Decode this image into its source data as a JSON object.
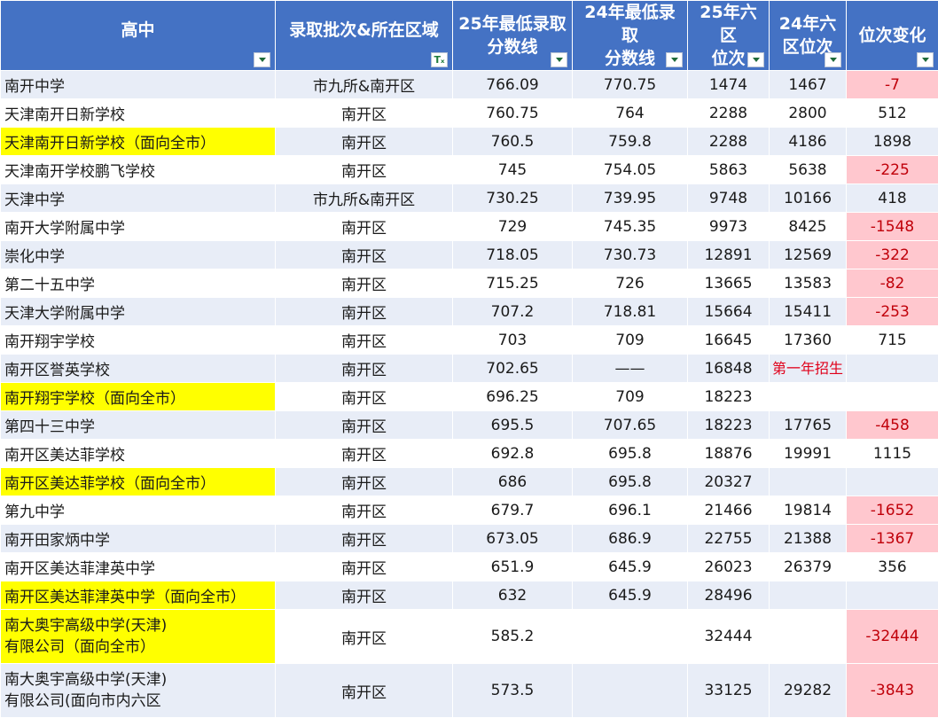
{
  "headers": [
    {
      "label": "高中"
    },
    {
      "label": "录取批次&所在区域"
    },
    {
      "label": "25年最低录取\n分数线"
    },
    {
      "label": "24年最低录取\n分数线"
    },
    {
      "label": "25年六区\n位次"
    },
    {
      "label": "24年六\n区位次"
    },
    {
      "label": "位次变化"
    }
  ],
  "rows": [
    {
      "name": "南开中学",
      "batch": "市九所&南开区",
      "s25": "766.09",
      "s24": "770.75",
      "r25": "1474",
      "r24": "1467",
      "chg": "-7"
    },
    {
      "name": "天津南开日新学校",
      "batch": "南开区",
      "s25": "760.75",
      "s24": "764",
      "r25": "2288",
      "r24": "2800",
      "chg": "512"
    },
    {
      "name": "天津南开日新学校（面向全市）",
      "batch": "南开区",
      "s25": "760.5",
      "s24": "759.8",
      "r25": "2288",
      "r24": "4186",
      "chg": "1898"
    },
    {
      "name": "天津南开学校鹏飞学校",
      "batch": "南开区",
      "s25": "745",
      "s24": "754.05",
      "r25": "5863",
      "r24": "5638",
      "chg": "-225"
    },
    {
      "name": "天津中学",
      "batch": "市九所&南开区",
      "s25": "730.25",
      "s24": "739.95",
      "r25": "9748",
      "r24": "10166",
      "chg": "418"
    },
    {
      "name": "南开大学附属中学",
      "batch": "南开区",
      "s25": "729",
      "s24": "745.35",
      "r25": "9973",
      "r24": "8425",
      "chg": "-1548"
    },
    {
      "name": "崇化中学",
      "batch": "南开区",
      "s25": "718.05",
      "s24": "730.73",
      "r25": "12891",
      "r24": "12569",
      "chg": "-322"
    },
    {
      "name": "第二十五中学",
      "batch": "南开区",
      "s25": "715.25",
      "s24": "726",
      "r25": "13665",
      "r24": "13583",
      "chg": "-82"
    },
    {
      "name": "天津大学附属中学",
      "batch": "南开区",
      "s25": "707.2",
      "s24": "718.81",
      "r25": "15664",
      "r24": "15411",
      "chg": "-253"
    },
    {
      "name": "南开翔宇学校",
      "batch": "南开区",
      "s25": "703",
      "s24": "709",
      "r25": "16645",
      "r24": "17360",
      "chg": "715"
    },
    {
      "name": "南开区誉英学校",
      "batch": "南开区",
      "s25": "702.65",
      "s24": "——",
      "r25": "16848",
      "r24": "第一年招生",
      "chg": ""
    },
    {
      "name": "南开翔宇学校（面向全市）",
      "batch": "南开区",
      "s25": "696.25",
      "s24": "709",
      "r25": "18223",
      "r24": "",
      "chg": ""
    },
    {
      "name": "第四十三中学",
      "batch": "南开区",
      "s25": "695.5",
      "s24": "707.65",
      "r25": "18223",
      "r24": "17765",
      "chg": "-458"
    },
    {
      "name": "南开区美达菲学校",
      "batch": "南开区",
      "s25": "692.8",
      "s24": "695.8",
      "r25": "18876",
      "r24": "19991",
      "chg": "1115"
    },
    {
      "name": "南开区美达菲学校（面向全市）",
      "batch": "南开区",
      "s25": "686",
      "s24": "695.8",
      "r25": "20327",
      "r24": "",
      "chg": ""
    },
    {
      "name": "第九中学",
      "batch": "南开区",
      "s25": "679.7",
      "s24": "696.1",
      "r25": "21466",
      "r24": "19814",
      "chg": "-1652"
    },
    {
      "name": "南开田家炳中学",
      "batch": "南开区",
      "s25": "673.05",
      "s24": "686.9",
      "r25": "22755",
      "r24": "21388",
      "chg": "-1367"
    },
    {
      "name": "南开区美达菲津英中学",
      "batch": "南开区",
      "s25": "651.9",
      "s24": "645.9",
      "r25": "26023",
      "r24": "26379",
      "chg": "356"
    },
    {
      "name": "南开区美达菲津英中学（面向全市）",
      "batch": "南开区",
      "s25": "632",
      "s24": "645.9",
      "r25": "28496",
      "r24": "",
      "chg": ""
    },
    {
      "name": "南大奥宇高级中学(天津)\n有限公司（面向全市）",
      "batch": "南开区",
      "s25": "585.2",
      "s24": "",
      "r25": "32444",
      "r24": "",
      "chg": "-32444"
    },
    {
      "name": "南大奥宇高级中学(天津)\n有限公司(面向市内六区",
      "batch": "南开区",
      "s25": "573.5",
      "s24": "",
      "r25": "33125",
      "r24": "29282",
      "chg": "-3843"
    }
  ],
  "colors": {
    "header_bg": "#4472c4",
    "highlight": "#ffff00",
    "negative_bg": "#ffc7ce",
    "negative_text": "#c0000a",
    "band": "#e8edf7"
  },
  "icons": {
    "dropdown": "chevron-down-icon",
    "active_filter": "filter-icon"
  }
}
